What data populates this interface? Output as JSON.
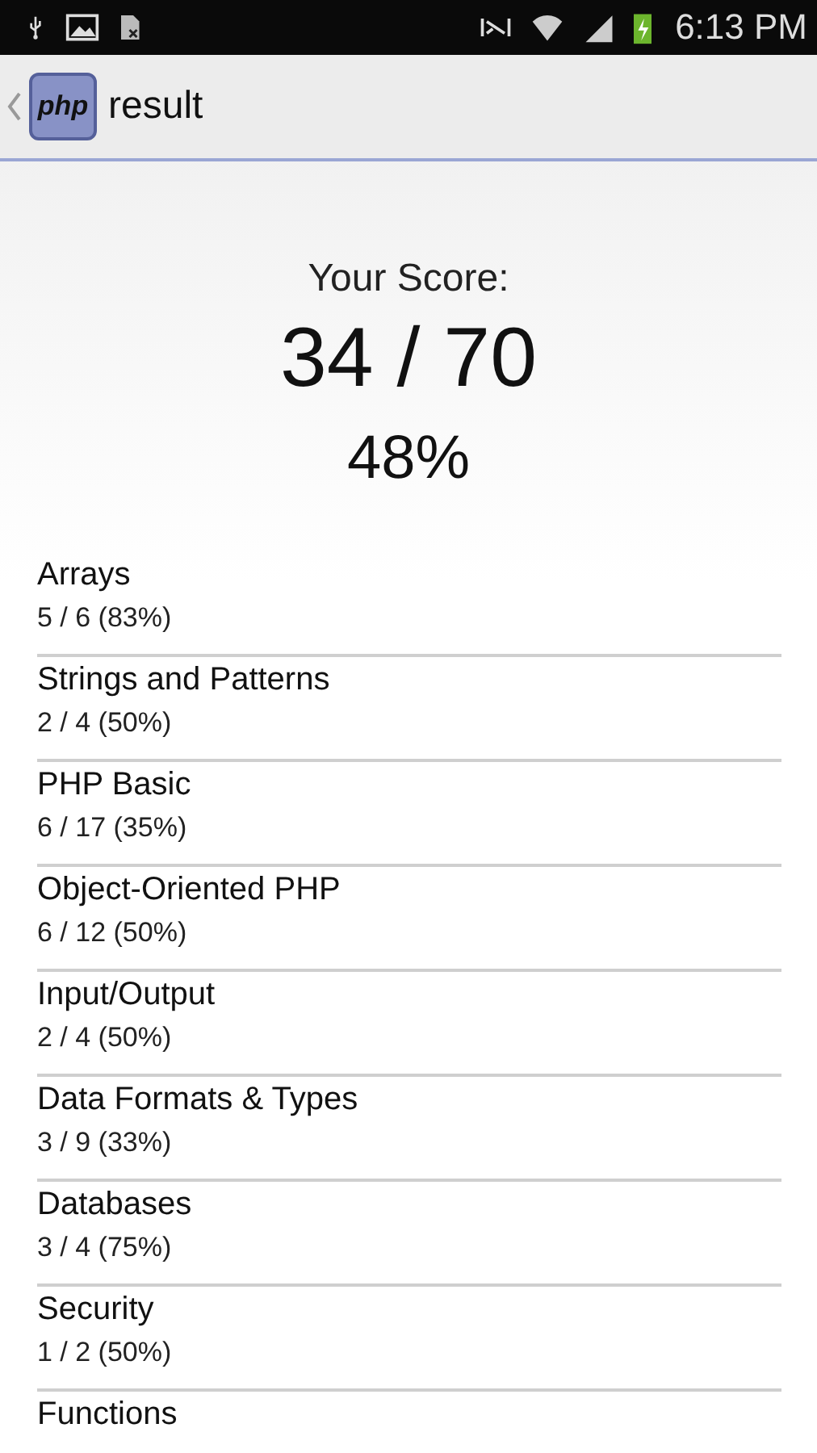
{
  "status_bar": {
    "time": "6:13 PM"
  },
  "action_bar": {
    "logo": "php",
    "title": "result"
  },
  "score": {
    "label": "Your Score:",
    "value": "34 / 70",
    "percent": "48%"
  },
  "categories": [
    {
      "name": "Arrays",
      "result": "5 / 6 (83%)"
    },
    {
      "name": "Strings and Patterns",
      "result": "2 / 4 (50%)"
    },
    {
      "name": "PHP Basic",
      "result": "6 / 17 (35%)"
    },
    {
      "name": "Object-Oriented PHP",
      "result": "6 / 12 (50%)"
    },
    {
      "name": "Input/Output",
      "result": "2 / 4 (50%)"
    },
    {
      "name": "Data Formats & Types",
      "result": "3 / 9 (33%)"
    },
    {
      "name": "Databases",
      "result": "3 / 4 (75%)"
    },
    {
      "name": "Security",
      "result": "1 / 2 (50%)"
    },
    {
      "name": "Functions"
    }
  ]
}
